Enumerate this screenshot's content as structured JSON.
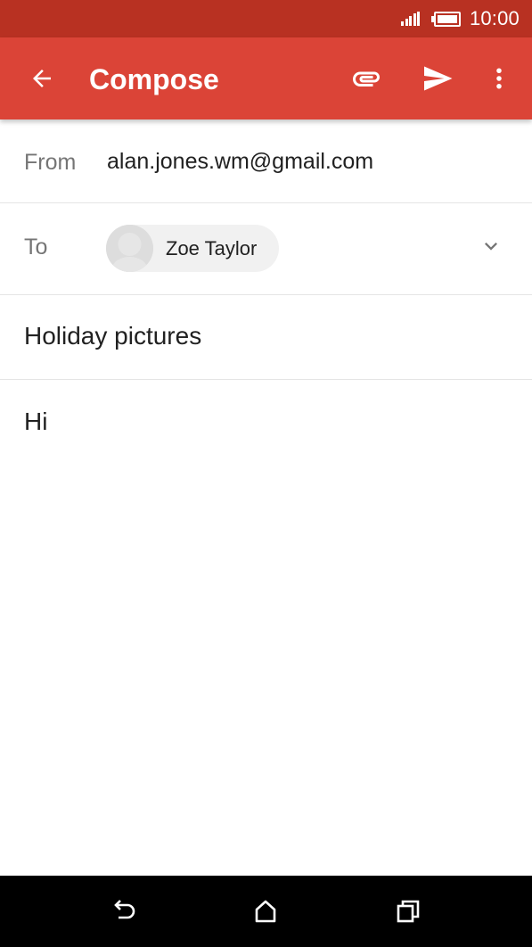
{
  "status_bar": {
    "time": "10:00"
  },
  "app_bar": {
    "title": "Compose",
    "color": "#db4437",
    "icons": [
      "back-arrow-icon",
      "paperclip-icon",
      "send-icon",
      "more-vert-icon"
    ]
  },
  "compose": {
    "from_label": "From",
    "from_value": "alan.jones.wm@gmail.com",
    "to_label": "To",
    "to_recipient": "Zoe Taylor",
    "subject": "Holiday pictures",
    "body": "Hi"
  },
  "nav_bar": {
    "icons": [
      "back-icon",
      "home-icon",
      "recent-apps-icon"
    ]
  }
}
